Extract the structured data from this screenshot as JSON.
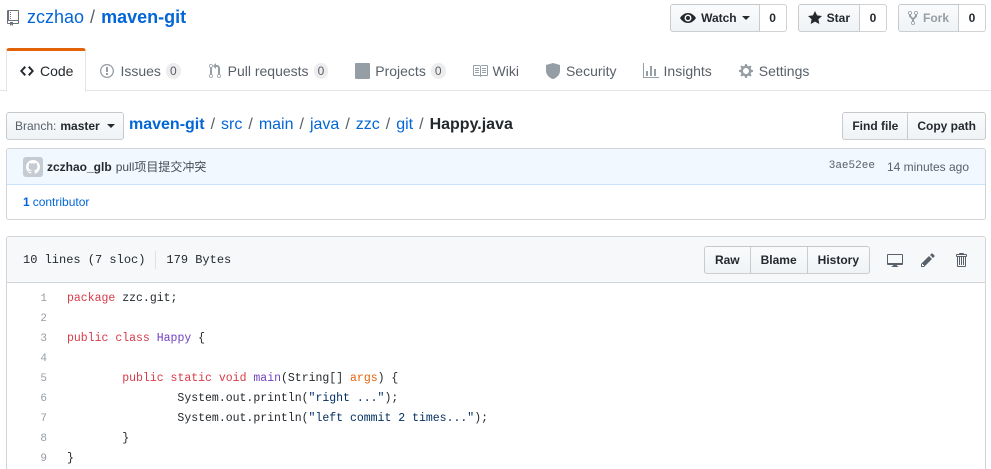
{
  "repo": {
    "owner": "zczhao",
    "separator": "/",
    "name": "maven-git"
  },
  "actions": {
    "watch": {
      "label": "Watch",
      "count": "0"
    },
    "star": {
      "label": "Star",
      "count": "0"
    },
    "fork": {
      "label": "Fork",
      "count": "0"
    }
  },
  "tabs": [
    {
      "label": "Code",
      "icon": "code-icon",
      "selected": true
    },
    {
      "label": "Issues",
      "icon": "issue-icon",
      "counter": "0"
    },
    {
      "label": "Pull requests",
      "icon": "pull-request-icon",
      "counter": "0"
    },
    {
      "label": "Projects",
      "icon": "project-icon",
      "counter": "0"
    },
    {
      "label": "Wiki",
      "icon": "book-icon"
    },
    {
      "label": "Security",
      "icon": "shield-icon"
    },
    {
      "label": "Insights",
      "icon": "graph-icon"
    },
    {
      "label": "Settings",
      "icon": "gear-icon"
    }
  ],
  "branch": {
    "label": "Branch:",
    "name": "master"
  },
  "breadcrumb": {
    "root": "maven-git",
    "path": [
      "src",
      "main",
      "java",
      "zzc",
      "git"
    ],
    "file": "Happy.java"
  },
  "nav_buttons": {
    "find_file": "Find file",
    "copy_path": "Copy path"
  },
  "commit": {
    "author": "zczhao_glb",
    "message": "pull项目提交冲突",
    "sha": "3ae52ee",
    "time": "14 minutes ago"
  },
  "contributors": {
    "count": "1",
    "label": "contributor"
  },
  "file": {
    "lines_info": "10 lines (7 sloc)",
    "size": "179 Bytes",
    "buttons": {
      "raw": "Raw",
      "blame": "Blame",
      "history": "History"
    },
    "code": [
      {
        "n": "1",
        "text": "package zzc.git;"
      },
      {
        "n": "2",
        "text": ""
      },
      {
        "n": "3",
        "text": "public class Happy {"
      },
      {
        "n": "4",
        "text": ""
      },
      {
        "n": "5",
        "text": "\tpublic static void main(String[] args) {"
      },
      {
        "n": "6",
        "text": "\t\tSystem.out.println(\"right ...\");"
      },
      {
        "n": "7",
        "text": "\t\tSystem.out.println(\"left commit 2 times...\");"
      },
      {
        "n": "8",
        "text": "\t}"
      },
      {
        "n": "9",
        "text": "}"
      }
    ]
  },
  "colors": {
    "link": "#0366d6",
    "tab_accent": "#e36209",
    "keyword": "#d73a49",
    "entity": "#6f42c1",
    "string": "#032f62",
    "parameter": "#e36209"
  }
}
